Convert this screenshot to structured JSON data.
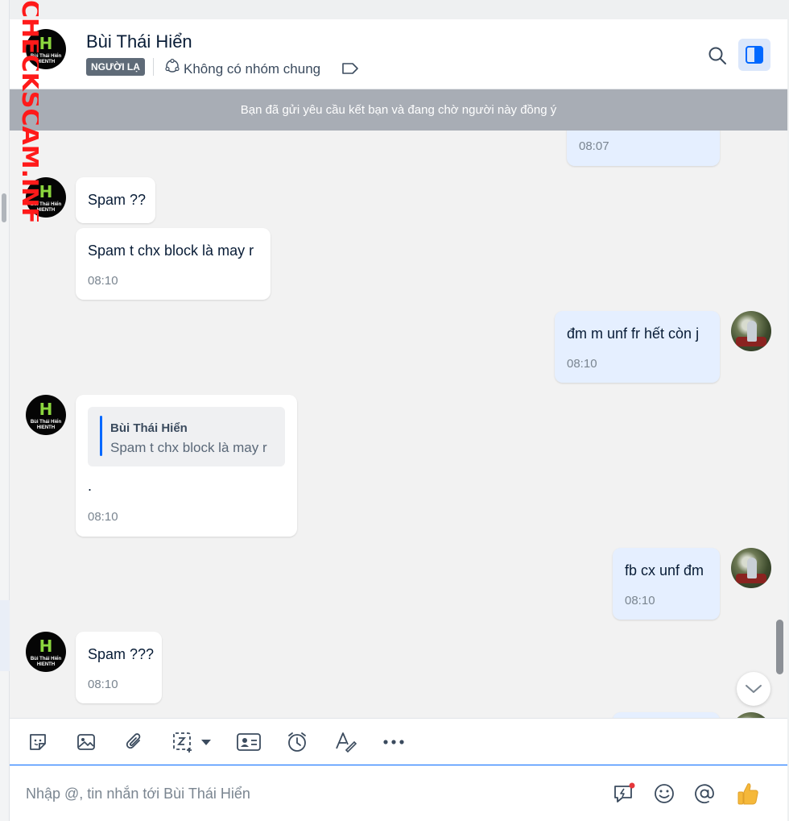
{
  "watermark": {
    "text": "CHECKSCAM.INFO",
    "color": "#ff1a1a"
  },
  "header": {
    "name": "Bùi Thái Hiển",
    "tag": "NGƯỜI LẠ",
    "group_text": "Không có nhóm chung",
    "avatar_logo": "H",
    "avatar_caption_1": "Bùi Thái Hiển",
    "avatar_caption_2": "HIENTH"
  },
  "banner": {
    "text": "Bạn đã gửi yêu cầu kết bạn và đang chờ người này đồng ý"
  },
  "messages": [
    {
      "from": "me",
      "text": "",
      "time": "08:07"
    },
    {
      "from": "them",
      "text": "Spam ??",
      "time": ""
    },
    {
      "from": "them",
      "text": "Spam t chx block là may r",
      "time": "08:10"
    },
    {
      "from": "me",
      "text": "đm m unf fr hết còn j",
      "time": "08:10"
    },
    {
      "from": "them",
      "quote_name": "Bùi Thái Hiển",
      "quote_text": "Spam t chx block là may r",
      "text": ".",
      "time": "08:10"
    },
    {
      "from": "me",
      "text": "fb cx unf đm",
      "time": "08:10"
    },
    {
      "from": "them",
      "text": "Spam ???",
      "time": "08:10"
    }
  ],
  "toolbar": {
    "icons": [
      "sticker-icon",
      "image-icon",
      "attachment-icon",
      "screenshot-icon",
      "contact-card-icon",
      "reminder-icon",
      "text-format-icon",
      "more-icon"
    ]
  },
  "composer": {
    "placeholder": "Nhập @, tin nhắn tới Bùi Thái Hiển",
    "value": ""
  },
  "colors": {
    "accent": "#0068ff",
    "my_bubble": "#e5efff",
    "banner": "#a8adb5",
    "tag": "#5f6b78"
  }
}
